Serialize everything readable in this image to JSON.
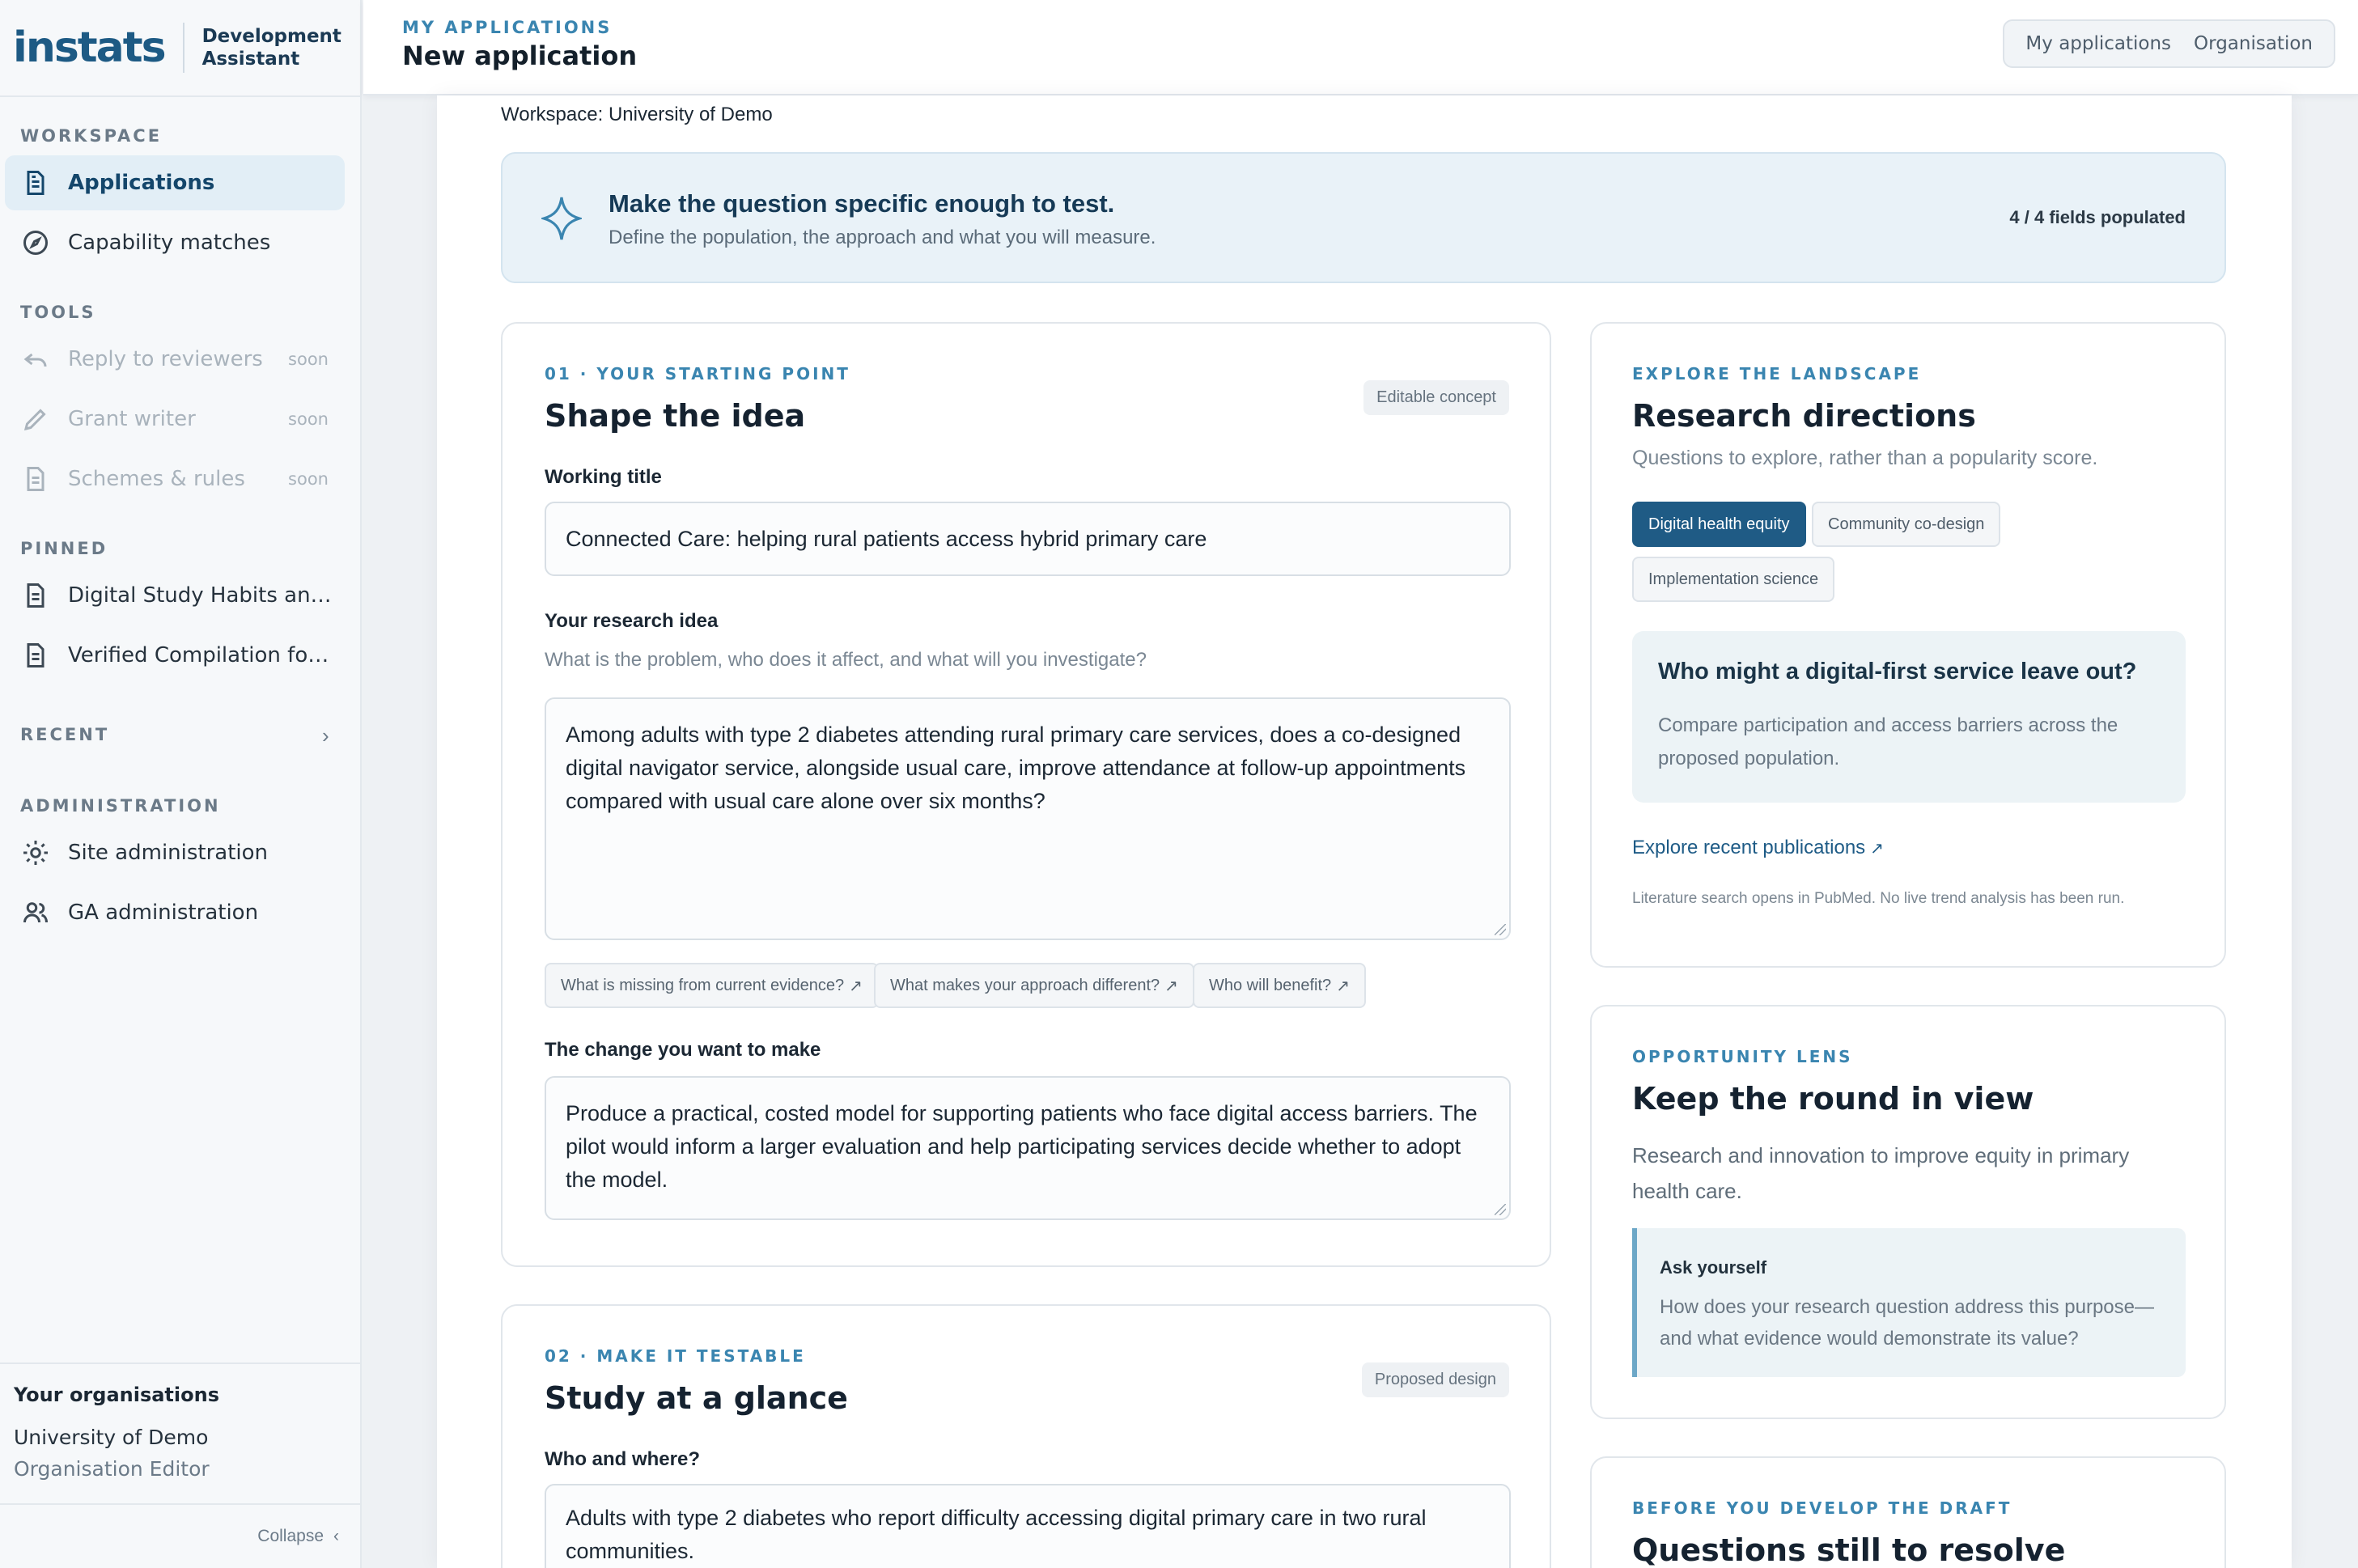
{
  "brand": {
    "logo": "instats",
    "subtitle_line1": "Development",
    "subtitle_line2": "Assistant"
  },
  "sidebar": {
    "sections": {
      "workspace": "WORKSPACE",
      "tools": "TOOLS",
      "pinned": "PINNED",
      "recent": "RECENT",
      "administration": "ADMINISTRATION"
    },
    "workspace_items": [
      {
        "label": "Applications",
        "icon": "document-icon",
        "active": true
      },
      {
        "label": "Capability matches",
        "icon": "compass-icon",
        "active": false
      }
    ],
    "tool_items": [
      {
        "label": "Reply to reviewers",
        "icon": "reply-icon",
        "badge": "soon"
      },
      {
        "label": "Grant writer",
        "icon": "pencil-icon",
        "badge": "soon"
      },
      {
        "label": "Schemes & rules",
        "icon": "document-icon",
        "badge": "soon"
      }
    ],
    "pinned_items": [
      {
        "label": "Digital Study Habits and...",
        "icon": "document-icon"
      },
      {
        "label": "Verified Compilation for ...",
        "icon": "document-icon"
      }
    ],
    "admin_items": [
      {
        "label": "Site administration",
        "icon": "gear-icon"
      },
      {
        "label": "GA administration",
        "icon": "users-icon"
      }
    ],
    "organisations": {
      "title": "Your organisations",
      "name": "University of Demo",
      "role": "Organisation Editor"
    },
    "collapse_label": "Collapse"
  },
  "header": {
    "breadcrumb": "MY APPLICATIONS",
    "title": "New application",
    "tabs": [
      "My applications",
      "Organisation"
    ]
  },
  "workspace_line": "Workspace: University of Demo",
  "banner": {
    "title": "Make the question specific enough to test.",
    "subtitle": "Define the population, the approach and what you will measure.",
    "count": "4 / 4 fields populated"
  },
  "idea_card": {
    "eyebrow": "01 · YOUR STARTING POINT",
    "title": "Shape the idea",
    "tag": "Editable concept",
    "working_title_label": "Working title",
    "working_title_value": "Connected Care: helping rural patients access hybrid primary care",
    "idea_label": "Your research idea",
    "idea_help": "What is the problem, who does it affect, and what will you investigate?",
    "idea_value": "Among adults with type 2 diabetes attending rural primary care services, does a co-designed digital navigator service, alongside usual care, improve attendance at follow-up appointments compared with usual care alone over six months?",
    "prompts": [
      "What is missing from current evidence?",
      "What makes your approach different?",
      "Who will benefit?"
    ],
    "change_label": "The change you want to make",
    "change_value": "Produce a practical, costed model for supporting patients who face digital access barriers. The pilot would inform a larger evaluation and help participating services decide whether to adopt the model."
  },
  "study_card": {
    "eyebrow": "02 · MAKE IT TESTABLE",
    "title": "Study at a glance",
    "tag": "Proposed design",
    "who_label": "Who and where?",
    "who_value": "Adults with type 2 diabetes who report difficulty accessing digital primary care in two rural communities."
  },
  "landscape_card": {
    "eyebrow": "EXPLORE THE LANDSCAPE",
    "title": "Research directions",
    "subtitle": "Questions to explore, rather than a popularity score.",
    "chips": [
      {
        "label": "Digital health equity",
        "active": true
      },
      {
        "label": "Community co-design",
        "active": false
      },
      {
        "label": "Implementation science",
        "active": false
      }
    ],
    "callout_title": "Who might a digital-first service leave out?",
    "callout_body": "Compare participation and access barriers across the proposed population.",
    "link": "Explore recent publications",
    "fineprint": "Literature search opens in PubMed. No live trend analysis has been run."
  },
  "lens_card": {
    "eyebrow": "OPPORTUNITY LENS",
    "title": "Keep the round in view",
    "body": "Research and innovation to improve equity in primary health care.",
    "quote_title": "Ask yourself",
    "quote_body": "How does your research question address this purpose—and what evidence would demonstrate its value?"
  },
  "resolve_card": {
    "eyebrow": "BEFORE YOU DEVELOP THE DRAFT",
    "title": "Questions still to resolve"
  },
  "colors": {
    "accent": "#1f5b85",
    "eyebrow": "#3a85b0",
    "banner_bg": "#e9f2f8"
  }
}
